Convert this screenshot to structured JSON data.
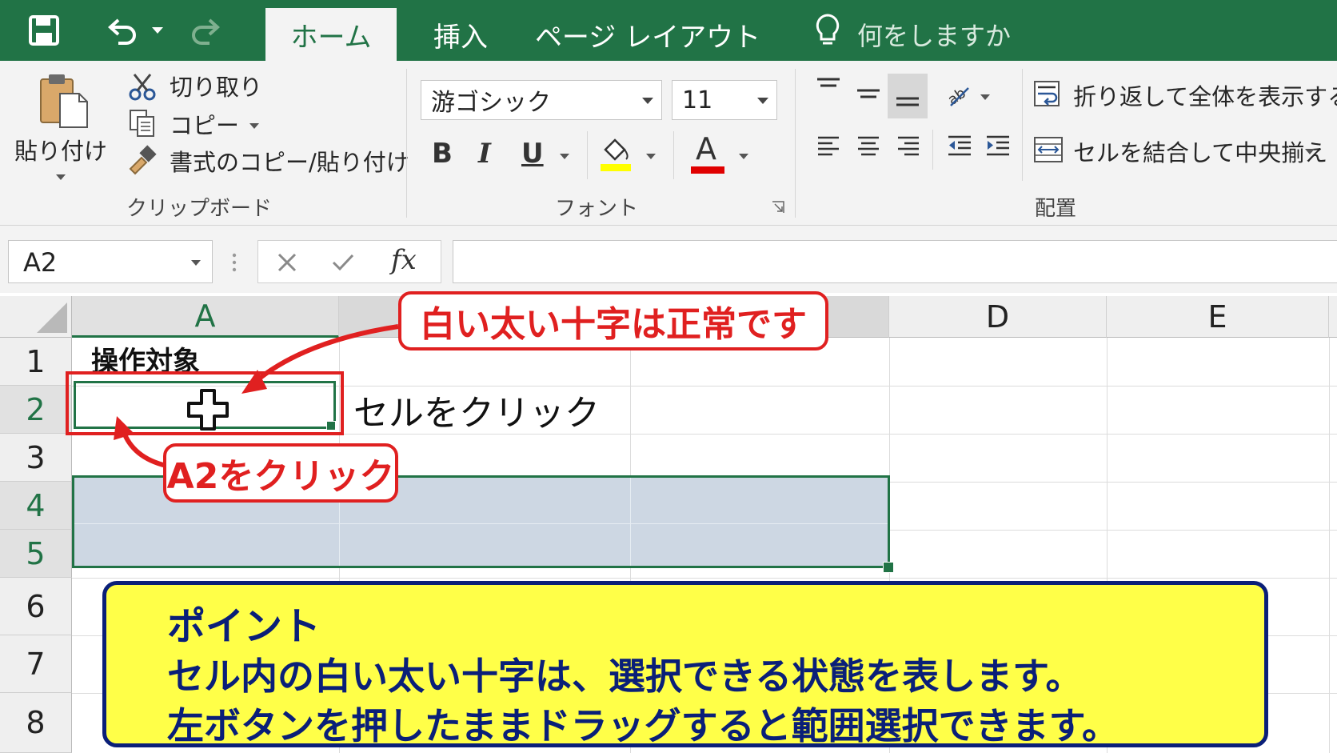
{
  "tabs": [
    {
      "label": "ホーム",
      "active": true
    },
    {
      "label": "挿入",
      "active": false
    },
    {
      "label": "ページ レイアウト",
      "active": false
    }
  ],
  "tell_me": "何をしますか",
  "clipboard": {
    "paste": "貼り付け",
    "cut": "切り取り",
    "copy": "コピー",
    "format_painter": "書式のコピー/貼り付け",
    "group": "クリップボード"
  },
  "font": {
    "name": "游ゴシック",
    "size": "11",
    "bold": "B",
    "italic": "I",
    "underline": "U",
    "font_color": "A",
    "group": "フォント",
    "highlight_color": "#ffff00",
    "text_color": "#e00000"
  },
  "alignment": {
    "wrap_text": "折り返して全体を表示する",
    "merge_center": "セルを結合して中央揃え",
    "group": "配置"
  },
  "formula_bar": {
    "name_box": "A2",
    "fx": "fx",
    "value": ""
  },
  "grid": {
    "columns": [
      "A",
      "D",
      "E"
    ],
    "rows": [
      "1",
      "2",
      "3",
      "4",
      "5",
      "6",
      "7",
      "8"
    ],
    "cells": {
      "A1": "操作対象",
      "B2": "セルをクリック"
    }
  },
  "annotations": {
    "cross_callout": "白い太い十字は正常です",
    "a2_callout": "A2をクリック",
    "point_title": "ポイント",
    "point_line1": "セル内の白い太い十字は、選択できる状態を表します。",
    "point_line2": "左ボタンを押したままドラッグすると範囲選択できます。"
  },
  "colors": {
    "excel_green": "#217346",
    "selection_fill": "#cdd7e3",
    "callout_red": "#e02020",
    "point_yellow": "#ffff48",
    "point_navy": "#0a1f78"
  }
}
